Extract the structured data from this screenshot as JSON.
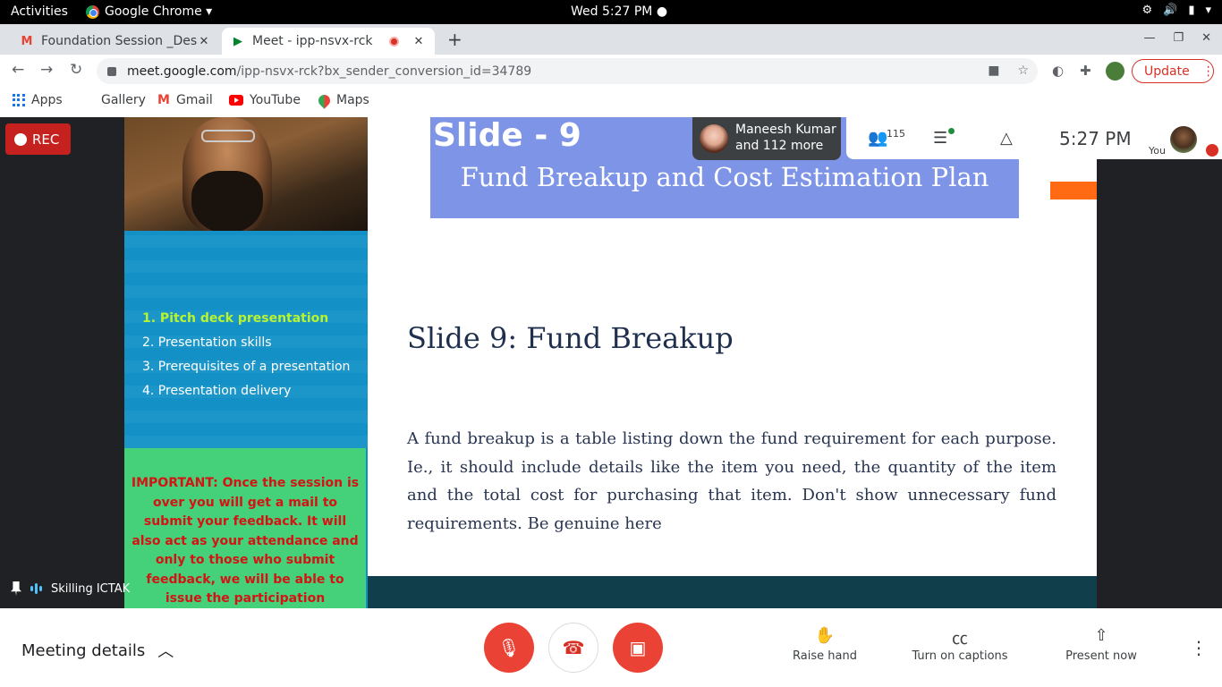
{
  "system": {
    "activities": "Activities",
    "app": "Google Chrome ▾",
    "clock": "Wed  5:27 PM ●"
  },
  "tabs": [
    {
      "title": "Foundation Session _Desi",
      "favicon": "gmail-icon"
    },
    {
      "title": "Meet - ipp-nsvx-rck",
      "favicon": "meet-icon",
      "recording": true
    }
  ],
  "omnibox": {
    "host": "meet.google.com",
    "path": "/ipp-nsvx-rck?bx_sender_conversion_id=34789"
  },
  "update_label": "Update",
  "bookmarks": [
    {
      "label": "Apps",
      "icon": "apps-grid-icon"
    },
    {
      "label": "Gallery",
      "icon": ""
    },
    {
      "label": "Gmail",
      "icon": "gmail-icon"
    },
    {
      "label": "YouTube",
      "icon": "youtube-icon"
    },
    {
      "label": "Maps",
      "icon": "maps-icon"
    }
  ],
  "meeting": {
    "rec_label": "REC",
    "participant_name": "Maneesh Kumar",
    "participant_more": "and 112 more",
    "people_count": "115",
    "time": "5:27  PM",
    "you_label": "You",
    "presenter_label": "Skilling ICTAK"
  },
  "slide": {
    "number": "Slide - 9",
    "subtitle": "Fund Breakup and Cost Estimation Plan",
    "heading": "Slide 9: Fund Breakup",
    "body": "A fund breakup is a table listing down the fund requirement for each purpose. Ie., it should include details like the item you need, the quantity of the item and the total cost for purchasing that item. Don't show unnecessary fund requirements. Be genuine here",
    "topics": [
      "1. Pitch deck presentation",
      "2. Presentation skills",
      "3. Prerequisites of a presentation",
      "4. Presentation delivery"
    ],
    "important": "IMPORTANT: Once the session is over you will get a mail to submit your feedback. It will also act as your attendance and only to those who submit feedback, we will be able to issue the participation certificate. Thank you."
  },
  "bottom": {
    "meeting_details": "Meeting details",
    "raise_hand": "Raise hand",
    "captions": "Turn on captions",
    "present": "Present now"
  },
  "colors": {
    "rec_red": "#c5221f",
    "slide_header": "#7e94e6",
    "important_bg": "#45d17a",
    "control_red": "#ea4335"
  }
}
